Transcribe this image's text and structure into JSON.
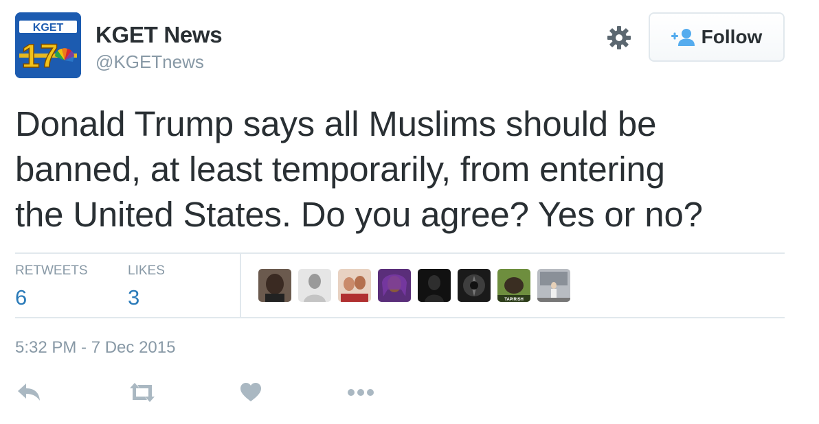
{
  "account": {
    "name": "KGET News",
    "handle": "@KGETnews",
    "logo_text": "KGET",
    "logo_number": "17"
  },
  "follow_button": {
    "label": "Follow"
  },
  "tweet": {
    "lines": [
      "Donald Trump says all Muslims should be",
      "banned, at least temporarily, from entering",
      "the United States. Do you agree? Yes or no?"
    ]
  },
  "stats": {
    "retweets_label": "RETWEETS",
    "retweets_value": "6",
    "likes_label": "LIKES",
    "likes_value": "3"
  },
  "likers": [
    {
      "icon": "user-avatar-1",
      "color": "#3a2a22"
    },
    {
      "icon": "user-avatar-2",
      "color": "#b9b9b9"
    },
    {
      "icon": "user-avatar-3",
      "color": "#c98a6a"
    },
    {
      "icon": "user-avatar-4",
      "color": "#5a2e7a"
    },
    {
      "icon": "user-avatar-5",
      "color": "#111111"
    },
    {
      "icon": "user-avatar-6",
      "color": "#2a2a2a"
    },
    {
      "icon": "user-avatar-7",
      "color": "#4e6e2e",
      "label": "TAPIRISH"
    },
    {
      "icon": "user-avatar-8",
      "color": "#9a9fa5"
    }
  ],
  "timestamp": "5:32 PM - 7 Dec 2015",
  "actions": [
    "reply-icon",
    "retweet-icon",
    "like-icon",
    "more-icon"
  ],
  "colors": {
    "text": "#292f33",
    "muted": "#8899a6",
    "link": "#2b7bb9",
    "follow_icon": "#55acee",
    "border": "#e1e8ed"
  }
}
